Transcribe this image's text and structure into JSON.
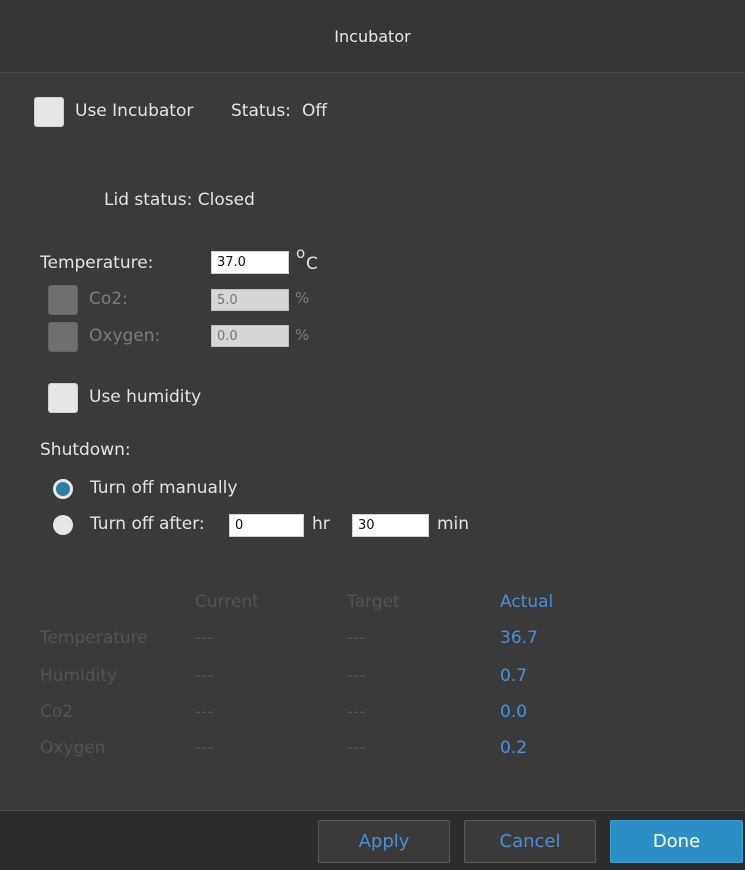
{
  "window": {
    "title": "Incubator"
  },
  "use_incubator": {
    "label": "Use Incubator",
    "checked": false
  },
  "status": {
    "label": "Status:",
    "value": "Off"
  },
  "lid_status": "Lid status: Closed",
  "temperature": {
    "label": "Temperature:",
    "value": "37.0",
    "unit_prefix": "o",
    "unit": "C"
  },
  "co2": {
    "label": "Co2:",
    "value": "5.0",
    "unit": "%",
    "enabled": false
  },
  "oxygen": {
    "label": "Oxygen:",
    "value": "0.0",
    "unit": "%",
    "enabled": false
  },
  "use_humidity": {
    "label": "Use humidity",
    "checked": false
  },
  "shutdown": {
    "label": "Shutdown:",
    "manual_label": "Turn off manually",
    "after_label": "Turn off after:",
    "selected": "manual",
    "hours": "0",
    "hours_unit": "hr",
    "minutes": "30",
    "minutes_unit": "min"
  },
  "readings": {
    "headers": {
      "current": "Current",
      "target": "Target",
      "actual": "Actual"
    },
    "rows": [
      {
        "name": "Temperature",
        "current": "---",
        "target": "---",
        "actual": "36.7"
      },
      {
        "name": "Humidity",
        "current": "---",
        "target": "---",
        "actual": "0.7"
      },
      {
        "name": "Co2",
        "current": "---",
        "target": "---",
        "actual": "0.0"
      },
      {
        "name": "Oxygen",
        "current": "---",
        "target": "---",
        "actual": "0.2"
      }
    ]
  },
  "buttons": {
    "apply": "Apply",
    "cancel": "Cancel",
    "done": "Done"
  },
  "colors": {
    "accent": "#2b8fc4",
    "actual_value": "#4a8fd8",
    "background": "#3a3a3a"
  }
}
